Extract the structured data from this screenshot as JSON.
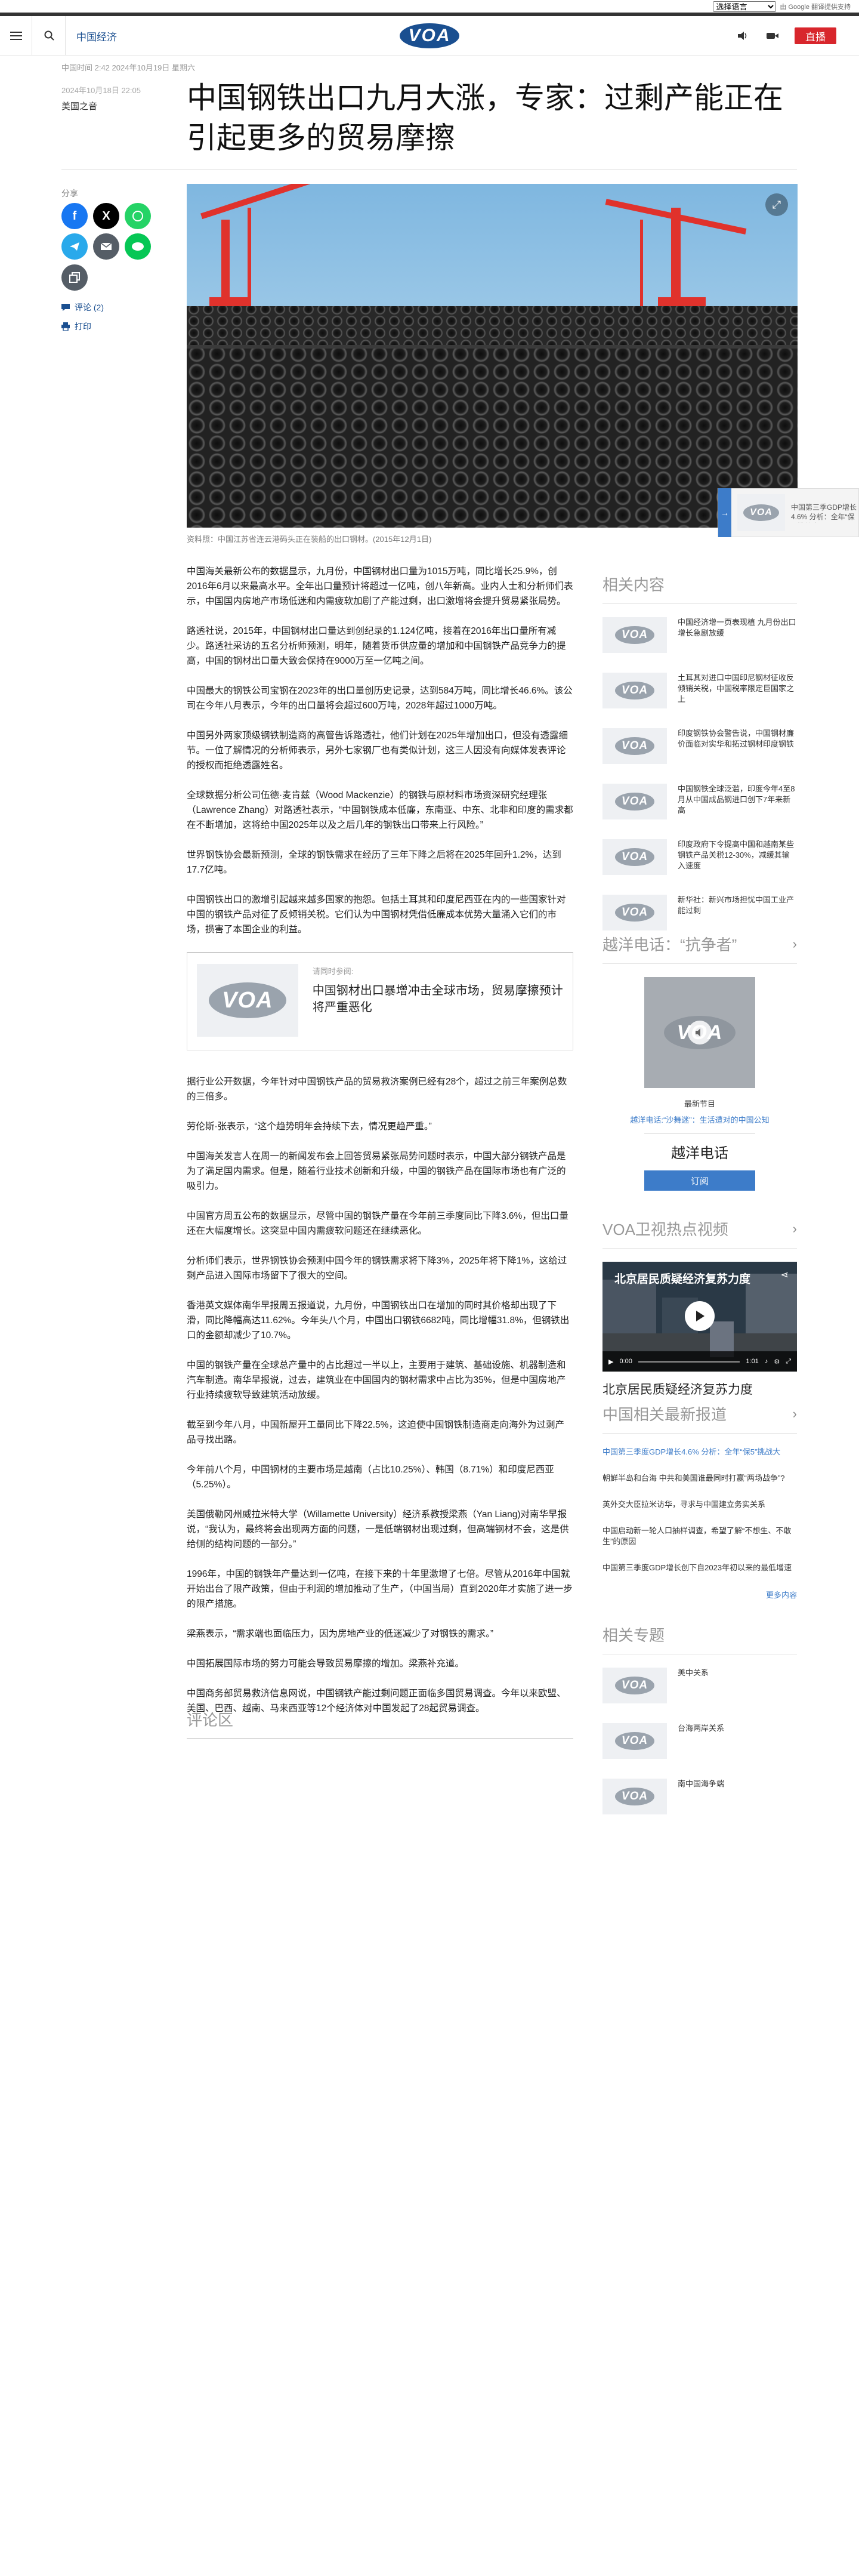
{
  "lang_select": {
    "value": "选择语言",
    "powered": "由 Google 翻译提供支持"
  },
  "header": {
    "section": "中国经济",
    "logo": "VOA",
    "live": "直播"
  },
  "intro": "中国时间 2:42 2024年10月19日 星期六",
  "article": {
    "datetime": "2024年10月18日 22:05",
    "category": "美国之音",
    "title": "中国钢铁出口九月大涨，专家：过剩产能正在引起更多的贸易摩擦",
    "share_label": "分享",
    "comments_link": "评论 (2)",
    "print_link": "打印",
    "caption": "资料照：中国江苏省连云港码头正在装船的出口钢材。(2015年12月1日)",
    "paragraphs": [
      "中国海关最新公布的数据显示，九月份，中国钢材出口量为1015万吨，同比增长25.9%，创2016年6月以来最高水平。全年出口量预计将超过一亿吨，创八年新高。业内人士和分析师们表示，中国国内房地产市场低迷和内需疲软加剧了产能过剩，出口激增将会提升贸易紧张局势。",
      "路透社说，2015年，中国钢材出口量达到创纪录的1.124亿吨，接着在2016年出口量所有减少。路透社采访的五名分析师预测，明年，随着货币供应量的增加和中国钢铁产品竞争力的提高，中国的钢材出口量大致会保持在9000万至一亿吨之间。",
      "中国最大的钢铁公司宝钢在2023年的出口量创历史记录，达到584万吨，同比增长46.6%。该公司在今年八月表示，今年的出口量将会超过600万吨，2028年超过1000万吨。",
      "中国另外两家顶级钢铁制造商的高管告诉路透社，他们计划在2025年增加出口，但没有透露细节。一位了解情况的分析师表示，另外七家钢厂也有类似计划，这三人因没有向媒体发表评论的授权而拒绝透露姓名。",
      "全球数据分析公司伍德·麦肯兹（Wood Mackenzie）的钢铁与原材料市场资深研究经理张（Lawrence Zhang）对路透社表示，“中国钢铁成本低廉，东南亚、中东、北非和印度的需求都在不断增加，这将给中国2025年以及之后几年的钢铁出口带来上行风险。”",
      "世界钢铁协会最新预测，全球的钢铁需求在经历了三年下降之后将在2025年回升1.2%，达到17.7亿吨。",
      "中国钢铁出口的激增引起越来越多国家的抱怨。包括土耳其和印度尼西亚在内的一些国家针对中国的钢铁产品对征了反倾销关税。它们认为中国钢材凭借低廉成本优势大量涌入它们的市场，损害了本国企业的利益。",
      "据行业公开数据，今年针对中国钢铁产品的贸易救济案例已经有28个，超过之前三年案例总数的三倍多。",
      "劳伦斯·张表示，“这个趋势明年会持续下去，情况更趋严重。”",
      "中国海关发言人在周一的新闻发布会上回答贸易紧张局势问题时表示，中国大部分钢铁产品是为了满足国内需求。但是，随着行业技术创新和升级，中国的钢铁产品在国际市场也有广泛的吸引力。",
      "中国官方周五公布的数据显示，尽管中国的钢铁产量在今年前三季度同比下降3.6%，但出口量还在大幅度增长。这突显中国内需疲软问题还在继续恶化。",
      "分析师们表示，世界钢铁协会预测中国今年的钢铁需求将下降3%，2025年将下降1%，这给过剩产品进入国际市场留下了很大的空间。",
      "香港英文媒体南华早报周五报道说，九月份，中国钢铁出口在增加的同时其价格却出现了下滑，同比降幅高达11.62%。今年头八个月，中国出口钢铁6682吨，同比增幅31.8%，但钢铁出口的金额却减少了10.7%。",
      "中国的钢铁产量在全球总产量中的占比超过一半以上，主要用于建筑、基础设施、机器制造和汽车制造。南华早报说，过去，建筑业在中国国内的钢材需求中占比为35%，但是中国房地产行业持续疲软导致建筑活动放缓。",
      "截至到今年八月，中国新屋开工量同比下降22.5%，这迫使中国钢铁制造商走向海外为过剩产品寻找出路。",
      "今年前八个月，中国钢材的主要市场是越南（占比10.25%）、韩国（8.71%）和印度尼西亚（5.25%）。",
      "美国俄勒冈州威拉米特大学（Willamette University）经济系教授梁燕（Yan Liang)对南华早报说，“我认为，最终将会出现两方面的问题，一是低端钢材出现过剩，但高端钢材不会，这是供给侧的结构问题的一部分。”",
      "1996年，中国的钢铁年产量达到一亿吨，在接下来的十年里激增了七倍。尽管从2016年中国就开始出台了限产政策，但由于利润的增加推动了生产，（中国当局）直到2020年才实施了进一步的限产措施。",
      "梁燕表示，“需求端也面临压力，因为房地产业的低迷减少了对钢铁的需求。”",
      "中国拓展国际市场的努力可能会导致贸易摩擦的增加。梁燕补充道。",
      "中国商务部贸易救济信息网说，中国钢铁产能过剩问题正面临多国贸易调查。今年以来欧盟、美国、巴西、越南、马来西亚等12个经济体对中国发起了28起贸易调查。"
    ]
  },
  "related_box": {
    "label": "请同时参阅:",
    "title": "中国钢材出口暴增冲击全球市场，贸易摩擦预计将严重恶化"
  },
  "comments_heading": "评论区",
  "sidebar": {
    "related_heading": "相关内容",
    "related": [
      "中国经济增一页表现植 九月份出口增长急剧放缓",
      "土耳其对进口中国印尼钢材征收反倾销关税，中国税率限定巨国家之上",
      "印度钢铁协会警告说，中国钢材廉价面临对实华和拓过钢材印度钢铁",
      "中国钢铁全球泛滥，印度今年4至8月从中国成品钢进口创下7年来新高",
      "印度政府下令提高中国和越南某些钢铁产品关税12-30%，减缓其输入速度",
      "新华社：新兴市场担忧中国工业产能过剩"
    ],
    "radio_heading": "越洋电话：“抗争者”",
    "radio_latest": "最新节目",
    "radio_episode": "越洋电话:“沙舞迷”：生活遭对的中国公知",
    "radio_name": "越洋电话",
    "subscribe": "订阅",
    "video_heading": "VOA卫视热点视频",
    "video_title_overlay": "北京居民质疑经济复苏力度",
    "video_time": "0:00",
    "video_dur": "1:01",
    "video_caption": "北京居民质疑经济复苏力度",
    "news_heading": "中国相关最新报道",
    "news": [
      "中国第三季度GDP增长4.6% 分析：全年“保5”挑战大",
      "朝鲜半岛和台海 中共和美国谁最同时打赢“两场战争”?",
      "英外交大臣拉米访华，寻求与中国建立务实关系",
      "中国启动新一轮人口抽样调查，希望了解“不想生、不敢生”的原因",
      "中国第三季度GDP增长创下自2023年初以来的最低增速"
    ],
    "more": "更多内容",
    "topics_heading": "相关专题",
    "topics": [
      "美中关系",
      "台海两岸关系",
      "南中国海争端"
    ]
  },
  "float_card": "中国第三季GDP增长4.6% 分析：全年“保5”挑战大"
}
